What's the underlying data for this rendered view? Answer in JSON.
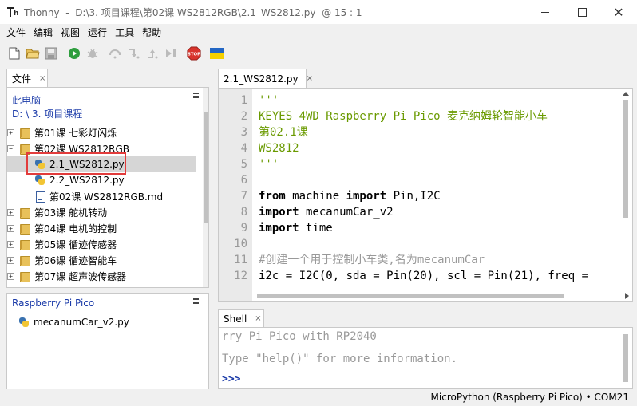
{
  "window": {
    "app_name": "Thonny",
    "path": "D:\\3. 项目课程\\第02课 WS2812RGB\\2.1_WS2812.py",
    "position": "@  15 : 1",
    "close_glyph": "✕"
  },
  "menu": [
    "文件",
    "编辑",
    "视图",
    "运行",
    "工具",
    "帮助"
  ],
  "toolbar": {
    "icons": [
      "new-file-icon",
      "open-file-icon",
      "save-icon",
      "run-icon",
      "debug-icon",
      "step-over-icon",
      "step-into-icon",
      "step-out-icon",
      "resume-icon",
      "stop-icon",
      "ukraine-flag-icon"
    ],
    "stop_label": "STOP",
    "colors": {
      "run": "#2e9e3e",
      "stop": "#d8342c",
      "flag_blue": "#2366c4",
      "flag_yellow": "#f5d000"
    }
  },
  "files": {
    "tab_label": "文件",
    "tab_close": "×",
    "location_title": "此电脑",
    "location_path": "D: \\ 3. 项目课程",
    "items": [
      {
        "label": "第01课 七彩灯闪烁",
        "kind": "folder",
        "expander": "+"
      },
      {
        "label": "第02课 WS2812RGB",
        "kind": "folder",
        "expander": "−"
      },
      {
        "label": "2.1_WS2812.py",
        "kind": "py",
        "selected": true
      },
      {
        "label": "2.2_WS2812.py",
        "kind": "py"
      },
      {
        "label": "第02课 WS2812RGB.md",
        "kind": "md"
      },
      {
        "label": "第03课 舵机转动",
        "kind": "folder",
        "expander": "+"
      },
      {
        "label": "第04课 电机的控制",
        "kind": "folder",
        "expander": "+"
      },
      {
        "label": "第05课 循迹传感器",
        "kind": "folder",
        "expander": "+"
      },
      {
        "label": "第06课 循迹智能车",
        "kind": "folder",
        "expander": "+"
      },
      {
        "label": "第07课 超声波传感器",
        "kind": "folder",
        "expander": "+"
      }
    ]
  },
  "device": {
    "title": "Raspberry Pi Pico",
    "items": [
      {
        "label": "mecanumCar_v2.py"
      }
    ]
  },
  "editor": {
    "tab_label": "2.1_WS2812.py",
    "tab_close": "×",
    "lines": [
      {
        "n": "1",
        "cls": "docstring",
        "text": "'''"
      },
      {
        "n": "2",
        "cls": "docstring",
        "text": "KEYES 4WD Raspberry Pi Pico 麦克纳姆轮智能小车"
      },
      {
        "n": "3",
        "cls": "docstring",
        "text": "第02.1课"
      },
      {
        "n": "4",
        "cls": "docstring",
        "text": "WS2812"
      },
      {
        "n": "5",
        "cls": "docstring",
        "text": "'''"
      },
      {
        "n": "6",
        "cls": "",
        "text": ""
      },
      {
        "n": "7",
        "cls": "",
        "kw1": "from",
        "mid": " machine ",
        "kw2": "import",
        "rest": " Pin,I2C"
      },
      {
        "n": "8",
        "cls": "",
        "kw1": "import",
        "rest": " mecanumCar_v2"
      },
      {
        "n": "9",
        "cls": "",
        "kw1": "import",
        "rest": " time"
      },
      {
        "n": "10",
        "cls": "",
        "text": ""
      },
      {
        "n": "11",
        "cls": "comment",
        "text": "#创建一个用于控制小车类,名为mecanumCar"
      },
      {
        "n": "12",
        "cls": "",
        "text": "i2c = I2C(0, sda = Pin(20), scl = Pin(21), freq = "
      }
    ]
  },
  "shell": {
    "tab_label": "Shell",
    "tab_close": "×",
    "lines": [
      "rry Pi Pico with RP2040",
      "Type \"help()\" for more information."
    ],
    "prompt": ">>>"
  },
  "status": {
    "interpreter": "MicroPython (Raspberry Pi Pico)  •  COM21"
  }
}
